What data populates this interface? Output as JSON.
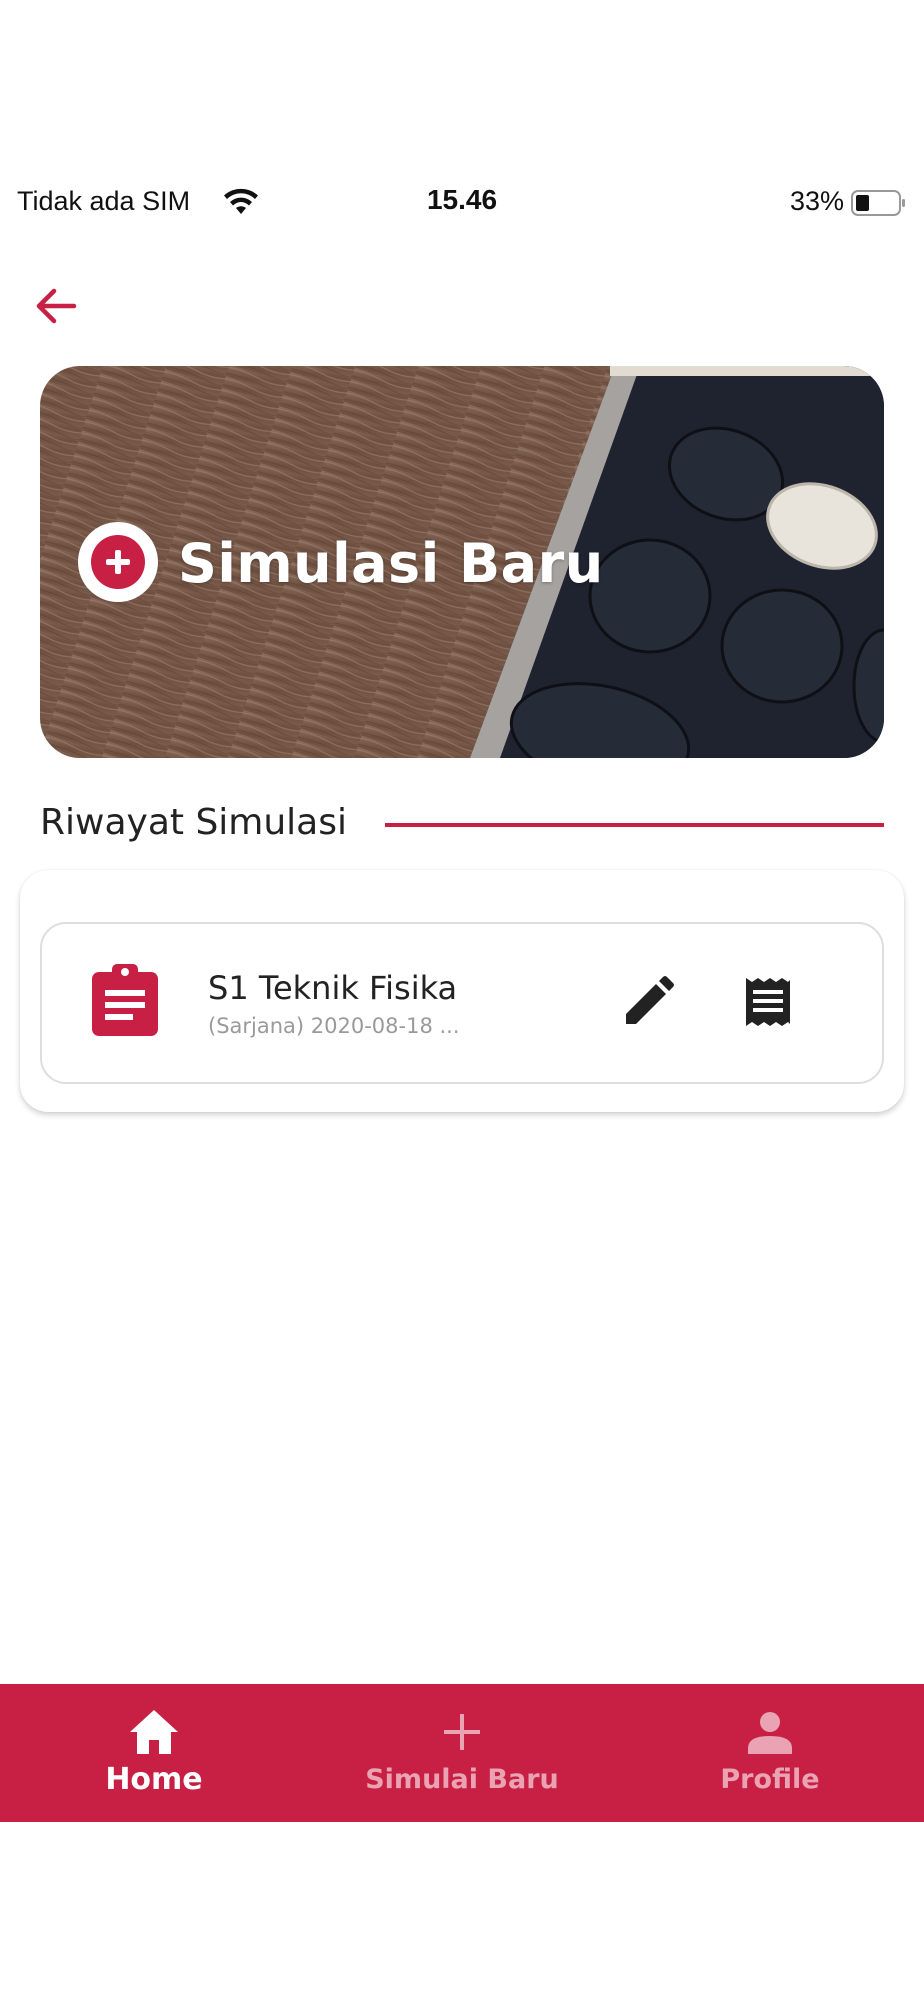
{
  "status_bar": {
    "carrier": "Tidak ada SIM",
    "time": "15.46",
    "battery": "33%"
  },
  "banner": {
    "title": "Simulasi Baru"
  },
  "section": {
    "title": "Riwayat Simulasi"
  },
  "history": {
    "items": [
      {
        "title": "S1 Teknik Fisika",
        "subtitle": "(Sarjana) 2020-08-18 ..."
      }
    ]
  },
  "bottom_nav": {
    "items": [
      {
        "label": "Home",
        "icon": "home-icon",
        "active": true
      },
      {
        "label": "Simulai Baru",
        "icon": "plus-icon",
        "active": false
      },
      {
        "label": "Profile",
        "icon": "person-icon",
        "active": false
      }
    ]
  },
  "colors": {
    "accent": "#c81f44",
    "inactive_nav_label": "#eaa3b3",
    "subtitle_gray": "#9a9a9a"
  }
}
